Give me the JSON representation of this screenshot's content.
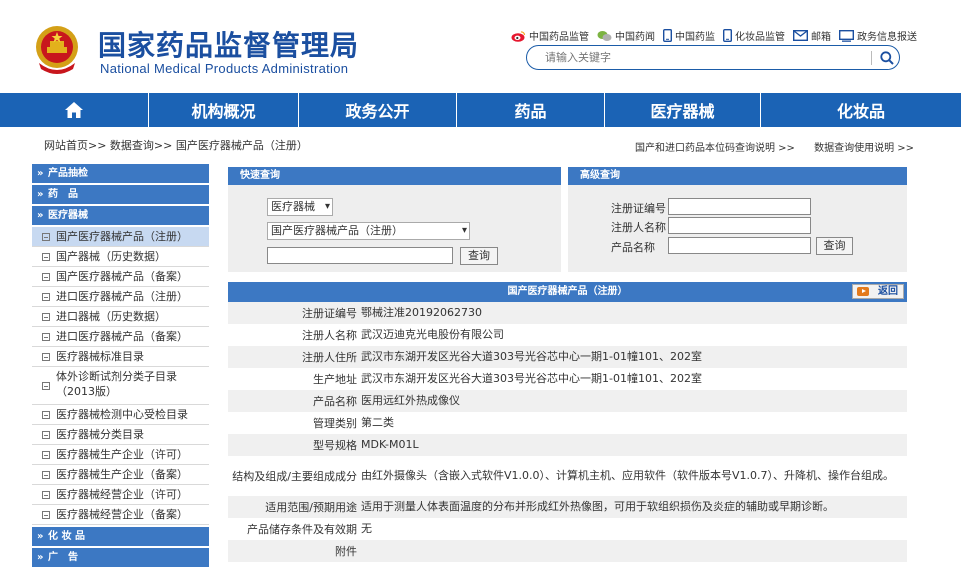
{
  "header": {
    "title_cn": "国家药品监督管理局",
    "title_en": "National Medical Products Administration",
    "top_links": [
      {
        "label": "中国药品监管",
        "icon": "weibo-icon"
      },
      {
        "label": "中国药闻",
        "icon": "wechat-icon"
      },
      {
        "label": "中国药监",
        "icon": "phone-icon"
      },
      {
        "label": "化妆品监管",
        "icon": "phone-icon"
      },
      {
        "label": "邮箱",
        "icon": "mail-icon"
      },
      {
        "label": "政务信息报送",
        "icon": "monitor-icon"
      }
    ],
    "search_placeholder": "请输入关键字"
  },
  "nav": {
    "items": [
      "机构概况",
      "政务公开",
      "药品",
      "医疗器械",
      "化妆品"
    ]
  },
  "breadcrumb": {
    "path": "网站首页>> 数据查询>> 国产医疗器械产品（注册）",
    "link1": "国产和进口药品本位码查询说明 >>",
    "link2": "数据查询使用说明 >>"
  },
  "sidebar": {
    "sections": {
      "s1": "产品抽检",
      "s2": "药　品",
      "s3": "医疗器械",
      "s4": "化 妆 品",
      "s5": "广　告"
    },
    "items": [
      "国产医疗器械产品（注册）",
      "国产器械（历史数据）",
      "国产医疗器械产品（备案）",
      "进口医疗器械产品（注册）",
      "进口器械（历史数据）",
      "进口医疗器械产品（备案）",
      "医疗器械标准目录",
      "体外诊断试剂分类子目录（2013版）",
      "医疗器械检测中心受检目录",
      "医疗器械分类目录",
      "医疗器械生产企业（许可）",
      "医疗器械生产企业（备案）",
      "医疗器械经营企业（许可）",
      "医疗器械经营企业（备案）"
    ],
    "active_index": 0
  },
  "quick_search": {
    "title": "快速查询",
    "category": "医疗器械",
    "subcategory": "国产医疗器械产品（注册）",
    "keyword": "",
    "button": "查询"
  },
  "advanced_search": {
    "title": "高级查询",
    "field1_label": "注册证编号",
    "field2_label": "注册人名称",
    "field3_label": "产品名称",
    "button": "查询"
  },
  "detail": {
    "title": "国产医疗器械产品（注册）",
    "back": "返回",
    "rows": [
      {
        "key": "注册证编号",
        "value": "鄂械注准20192062730"
      },
      {
        "key": "注册人名称",
        "value": "武汉迈迪克光电股份有限公司"
      },
      {
        "key": "注册人住所",
        "value": "武汉市东湖开发区光谷大道303号光谷芯中心一期1-01幢101、202室"
      },
      {
        "key": "生产地址",
        "value": "武汉市东湖开发区光谷大道303号光谷芯中心一期1-01幢101、202室"
      },
      {
        "key": "产品名称",
        "value": "医用远红外热成像仪"
      },
      {
        "key": "管理类别",
        "value": "第二类"
      },
      {
        "key": "型号规格",
        "value": "MDK-M01L"
      },
      {
        "key": "结构及组成/主要组成成分",
        "value": "由红外摄像头（含嵌入式软件V1.0.0）、计算机主机、应用软件（软件版本号V1.0.7）、升降机、操作台组成。"
      },
      {
        "key": "适用范围/预期用途",
        "value": "适用于测量人体表面温度的分布并形成红外热像图，可用于软组织损伤及炎症的辅助或早期诊断。"
      },
      {
        "key": "产品储存条件及有效期",
        "value": "无"
      },
      {
        "key": "附件",
        "value": ""
      }
    ]
  },
  "colors": {
    "nav": "#1b63b5",
    "panel_head": "#3c78c3",
    "brand_text": "#1b4fa0",
    "active_item": "#c7d9f1"
  }
}
